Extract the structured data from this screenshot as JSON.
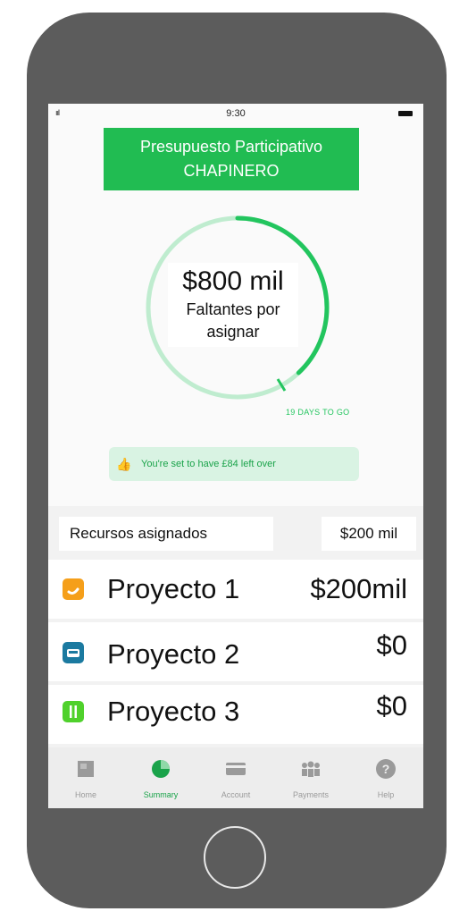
{
  "status_bar": {
    "signal": "ııl",
    "time": "9:30"
  },
  "banner": {
    "line1": "Presupuesto Participativo",
    "line2": "CHAPINERO"
  },
  "budget": {
    "amount": "$800 mil",
    "label_line1": "Faltantes por",
    "label_line2": "asignar",
    "progress_fraction": 0.38
  },
  "days_left": "19 DAYS TO GO",
  "notice": {
    "icon": "thumbs-up-icon",
    "text": "You're set to have £84 left over"
  },
  "allocated": {
    "label": "Recursos asignados",
    "amount": "$200 mil"
  },
  "projects": [
    {
      "name": "Proyecto 1",
      "value": "$200mil",
      "icon": "tag-icon",
      "color": "#f59f1a"
    },
    {
      "name": "Proyecto 2",
      "value": "$0",
      "icon": "car-icon",
      "color": "#1b7aa0"
    },
    {
      "name": "Proyecto 3",
      "value": "$0",
      "icon": "fork-knife-icon",
      "color": "#4fd12c"
    }
  ],
  "tabs": [
    {
      "label": "Home",
      "icon": "home-icon",
      "active": false
    },
    {
      "label": "Summary",
      "icon": "pie-chart-icon",
      "active": true
    },
    {
      "label": "Account",
      "icon": "card-icon",
      "active": false
    },
    {
      "label": "Payments",
      "icon": "people-icon",
      "active": false
    },
    {
      "label": "Help",
      "icon": "help-icon",
      "active": false
    }
  ],
  "colors": {
    "accent": "#21bc52",
    "ring_track": "#bfeccf"
  }
}
